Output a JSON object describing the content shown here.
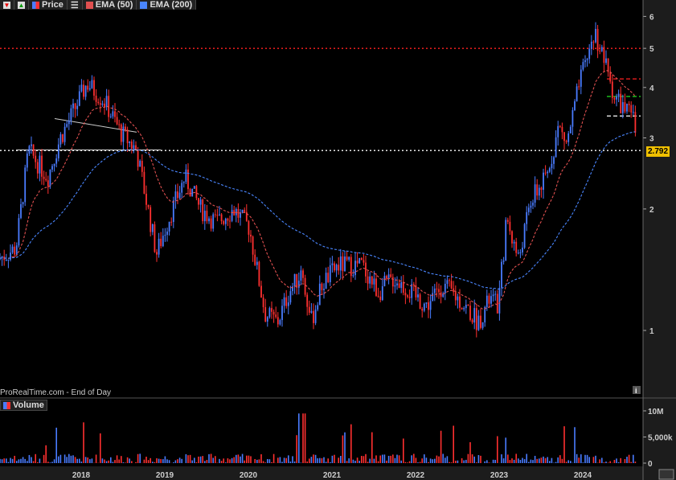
{
  "toolbar": {
    "price_label": "Price",
    "ema50_label": "EMA (50)",
    "ema200_label": "EMA (200)"
  },
  "footer": "ProRealTime.com - End of Day",
  "volume_label": "Volume",
  "last_price_label": "2.792",
  "colors": {
    "up": "#4a7cff",
    "down": "#ff3030",
    "ema50": "#e05050",
    "ema200": "#4a86ff",
    "background": "#000000"
  },
  "chart_data": {
    "type": "candlestick",
    "y_scale": "log",
    "y_ticks": [
      1,
      2,
      3,
      4,
      5,
      6
    ],
    "y_tick_labels": [
      "1",
      "2",
      "3",
      "4",
      "5",
      "6"
    ],
    "x_ticks": [
      2018,
      2019,
      2020,
      2021,
      2022,
      2023,
      2024
    ],
    "x_tick_labels": [
      "2018",
      "2019",
      "2020",
      "2021",
      "2022",
      "2023",
      "2024"
    ],
    "xlim": [
      2017.0,
      2024.72
    ],
    "ylim": [
      0.72,
      6.6
    ],
    "series_close": {
      "t": [
        2017.0,
        2017.22,
        2017.37,
        2017.6,
        2017.75,
        2017.94,
        2018.07,
        2018.28,
        2018.47,
        2018.66,
        2018.76,
        2018.9,
        2019.05,
        2019.24,
        2019.43,
        2019.62,
        2019.82,
        2020.01,
        2020.2,
        2020.35,
        2020.49,
        2020.64,
        2020.75,
        2020.88,
        2021.07,
        2021.36,
        2021.55,
        2021.74,
        2021.93,
        2022.13,
        2022.32,
        2022.51,
        2022.75,
        2022.89,
        2022.99,
        2023.09,
        2023.23,
        2023.38,
        2023.57,
        2023.71,
        2023.81,
        2023.95,
        2024.14,
        2024.24,
        2024.38,
        2024.52,
        2024.62,
        2024.65
      ],
      "price": [
        1.5,
        1.6,
        2.8,
        2.4,
        3.0,
        3.6,
        4.1,
        3.7,
        3.1,
        2.8,
        2.2,
        1.55,
        1.9,
        2.4,
        2.0,
        1.85,
        2.0,
        1.8,
        1.1,
        1.05,
        1.25,
        1.4,
        1.05,
        1.3,
        1.45,
        1.45,
        1.25,
        1.35,
        1.25,
        1.15,
        1.3,
        1.2,
        1.05,
        1.2,
        1.15,
        1.9,
        1.5,
        2.1,
        2.4,
        3.2,
        2.9,
        4.0,
        5.5,
        4.8,
        3.8,
        3.5,
        3.3,
        2.792
      ]
    },
    "indicators": [
      "EMA (50)",
      "EMA (200)"
    ],
    "horizontal_lines": [
      {
        "value": 5.0,
        "style": "dotted",
        "color": "#ff2020"
      },
      {
        "value": 2.792,
        "style": "dotted",
        "color": "#ffffff"
      },
      {
        "value": 4.2,
        "style": "dashed",
        "color": "#ff2020"
      },
      {
        "value": 3.8,
        "style": "dashed",
        "color": "#20e020"
      },
      {
        "value": 3.4,
        "style": "dashed",
        "color": "#ffffff"
      }
    ],
    "volume": {
      "y_ticks": [
        0,
        5000000,
        10000000
      ],
      "y_tick_labels": [
        "0",
        "5,000k",
        "10M"
      ]
    }
  }
}
